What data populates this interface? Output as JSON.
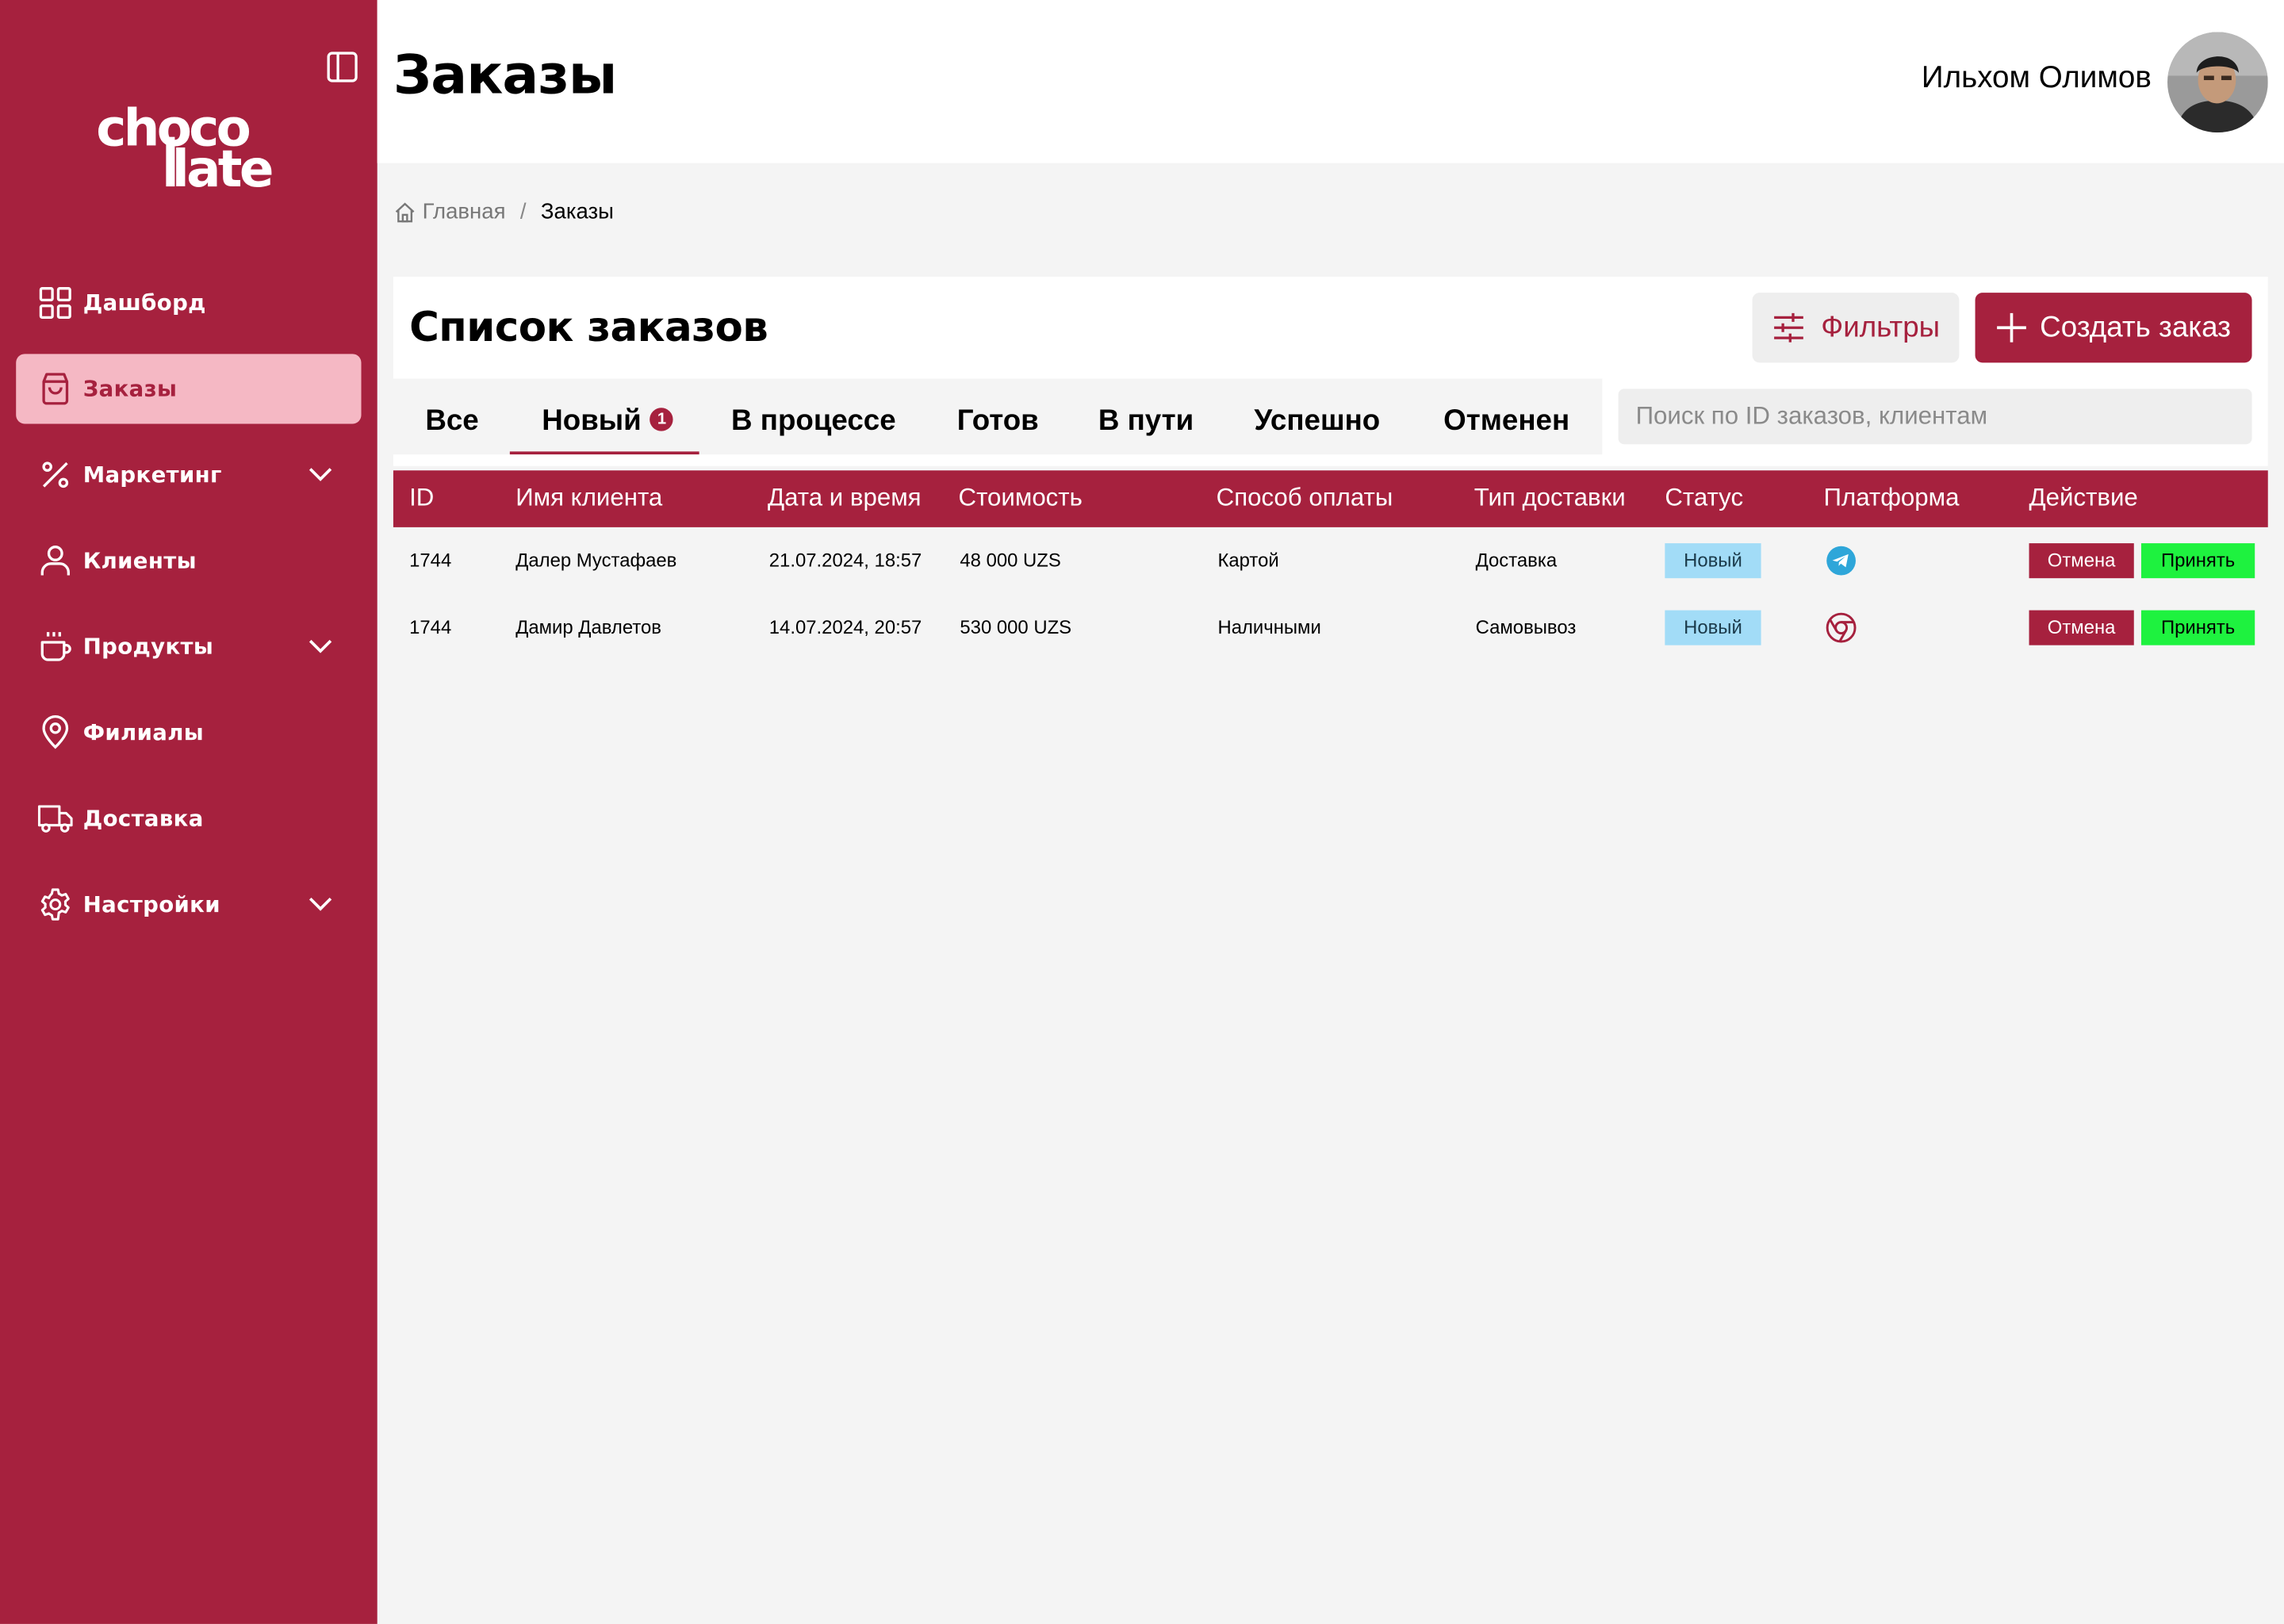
{
  "sidebar": {
    "logo_line1": "choco",
    "logo_line2": "late",
    "items": [
      {
        "label": "Дашборд",
        "icon": "grid-icon"
      },
      {
        "label": "Заказы",
        "icon": "shopping-bag-icon",
        "active": true
      },
      {
        "label": "Маркетинг",
        "icon": "percent-icon",
        "expandable": true
      },
      {
        "label": "Клиенты",
        "icon": "user-icon"
      },
      {
        "label": "Продукты",
        "icon": "coffee-cup-icon",
        "expandable": true
      },
      {
        "label": "Филиалы",
        "icon": "map-pin-icon"
      },
      {
        "label": "Доставка",
        "icon": "truck-icon"
      },
      {
        "label": "Настройки",
        "icon": "gear-icon",
        "expandable": true
      }
    ]
  },
  "header": {
    "title": "Заказы",
    "user_name": "Ильхом Олимов"
  },
  "breadcrumb": {
    "home": "Главная",
    "separator": "/",
    "current": "Заказы"
  },
  "orders": {
    "title": "Список заказов",
    "filters_label": "Фильтры",
    "create_label": "Создать заказ",
    "search_placeholder": "Поиск по ID заказов, клиентам",
    "tabs": [
      {
        "label": "Все"
      },
      {
        "label": "Новый",
        "badge": "1",
        "active": true
      },
      {
        "label": "В процессе"
      },
      {
        "label": "Готов"
      },
      {
        "label": "В пути"
      },
      {
        "label": "Успешно"
      },
      {
        "label": "Отменен"
      }
    ],
    "columns": [
      "ID",
      "Имя клиента",
      "Дата и время",
      "Стоимость",
      "Способ оплаты",
      "Тип доставки",
      "Статус",
      "Платформа",
      "Действие"
    ],
    "rows": [
      {
        "id": "1744",
        "client": "Далер Мустафаев",
        "datetime": "21.07.2024, 18:57",
        "cost": "48 000 UZS",
        "payment": "Картой",
        "delivery": "Доставка",
        "status": "Новый",
        "platform": "telegram-icon",
        "cancel": "Отмена",
        "accept": "Принять"
      },
      {
        "id": "1744",
        "client": "Дамир Давлетов",
        "datetime": "14.07.2024, 20:57",
        "cost": "530 000 UZS",
        "payment": "Наличными",
        "delivery": "Самовывоз",
        "status": "Новый",
        "platform": "chrome-icon",
        "cancel": "Отмена",
        "accept": "Принять"
      }
    ]
  },
  "colors": {
    "brand": "#a6213e",
    "active_nav_bg": "#f5b8c4",
    "status_new_bg": "#a2dcf7",
    "accept_bg": "#1ef23f",
    "page_bg": "#f4f4f4"
  }
}
